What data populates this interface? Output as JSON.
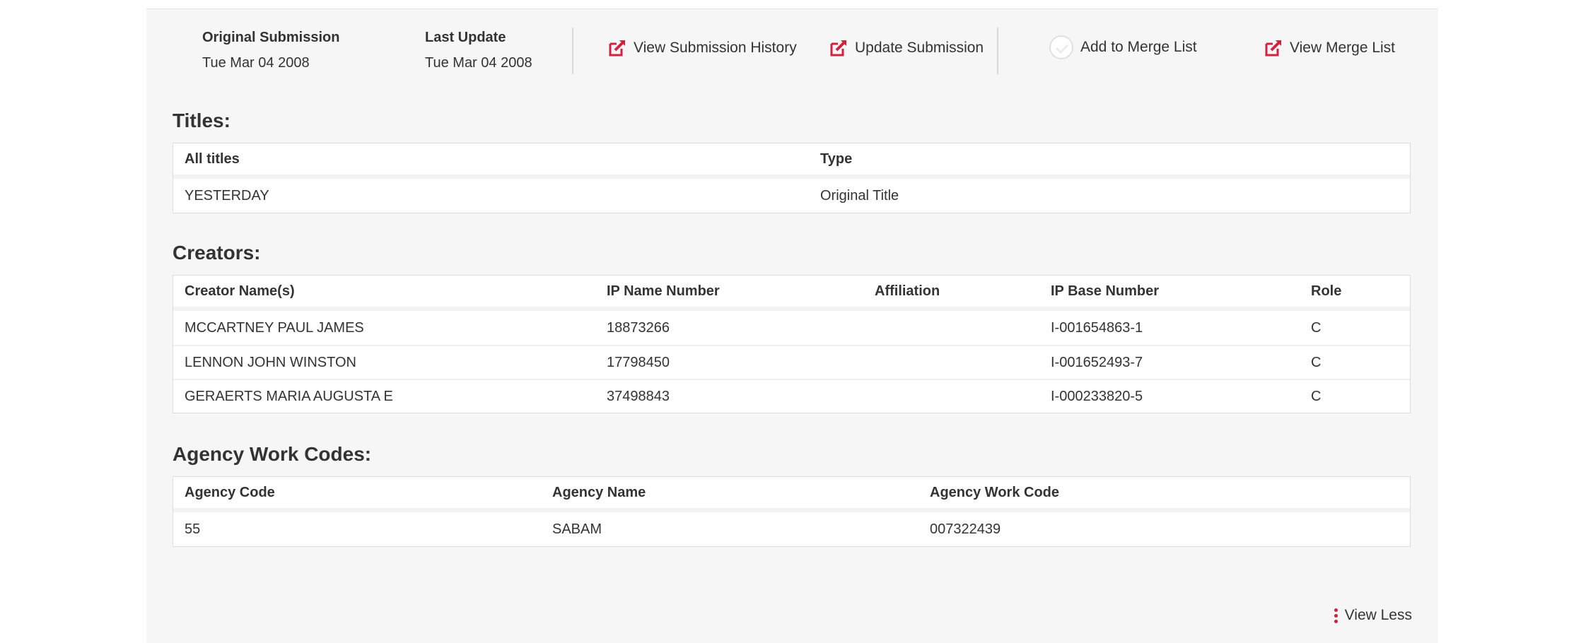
{
  "summary": {
    "original_submission": {
      "label": "Original Submission",
      "value": "Tue Mar 04 2008"
    },
    "last_update": {
      "label": "Last Update",
      "value": "Tue Mar 04 2008"
    }
  },
  "actions": {
    "view_history": {
      "label": "View Submission History",
      "icon": "external-edit-icon"
    },
    "update_submission": {
      "label": "Update Submission",
      "icon": "external-edit-icon"
    },
    "add_to_merge": {
      "label": "Add to Merge List",
      "icon": "checkbox-circle-icon"
    },
    "view_merge": {
      "label": "View Merge List",
      "icon": "external-edit-icon"
    }
  },
  "titles": {
    "heading": "Titles:",
    "columns": [
      "All titles",
      "Type"
    ],
    "rows": [
      [
        "YESTERDAY",
        "Original Title"
      ]
    ]
  },
  "creators": {
    "heading": "Creators:",
    "columns": [
      "Creator Name(s)",
      "IP Name Number",
      "Affiliation",
      "IP Base Number",
      "Role"
    ],
    "rows": [
      [
        "MCCARTNEY PAUL JAMES",
        "18873266",
        "",
        "I-001654863-1",
        "C"
      ],
      [
        "LENNON JOHN WINSTON",
        "17798450",
        "",
        "I-001652493-7",
        "C"
      ],
      [
        "GERAERTS MARIA AUGUSTA E",
        "37498843",
        "",
        "I-000233820-5",
        "C"
      ]
    ]
  },
  "agency": {
    "heading": "Agency Work Codes:",
    "columns": [
      "Agency Code",
      "Agency Name",
      "Agency Work Code"
    ],
    "rows": [
      [
        "55",
        "SABAM",
        "007322439"
      ]
    ]
  },
  "footer": {
    "view_less_label": "View Less"
  },
  "colors": {
    "accent": "#d4203d",
    "panel_bg": "#f6f6f6",
    "text": "#333333"
  }
}
